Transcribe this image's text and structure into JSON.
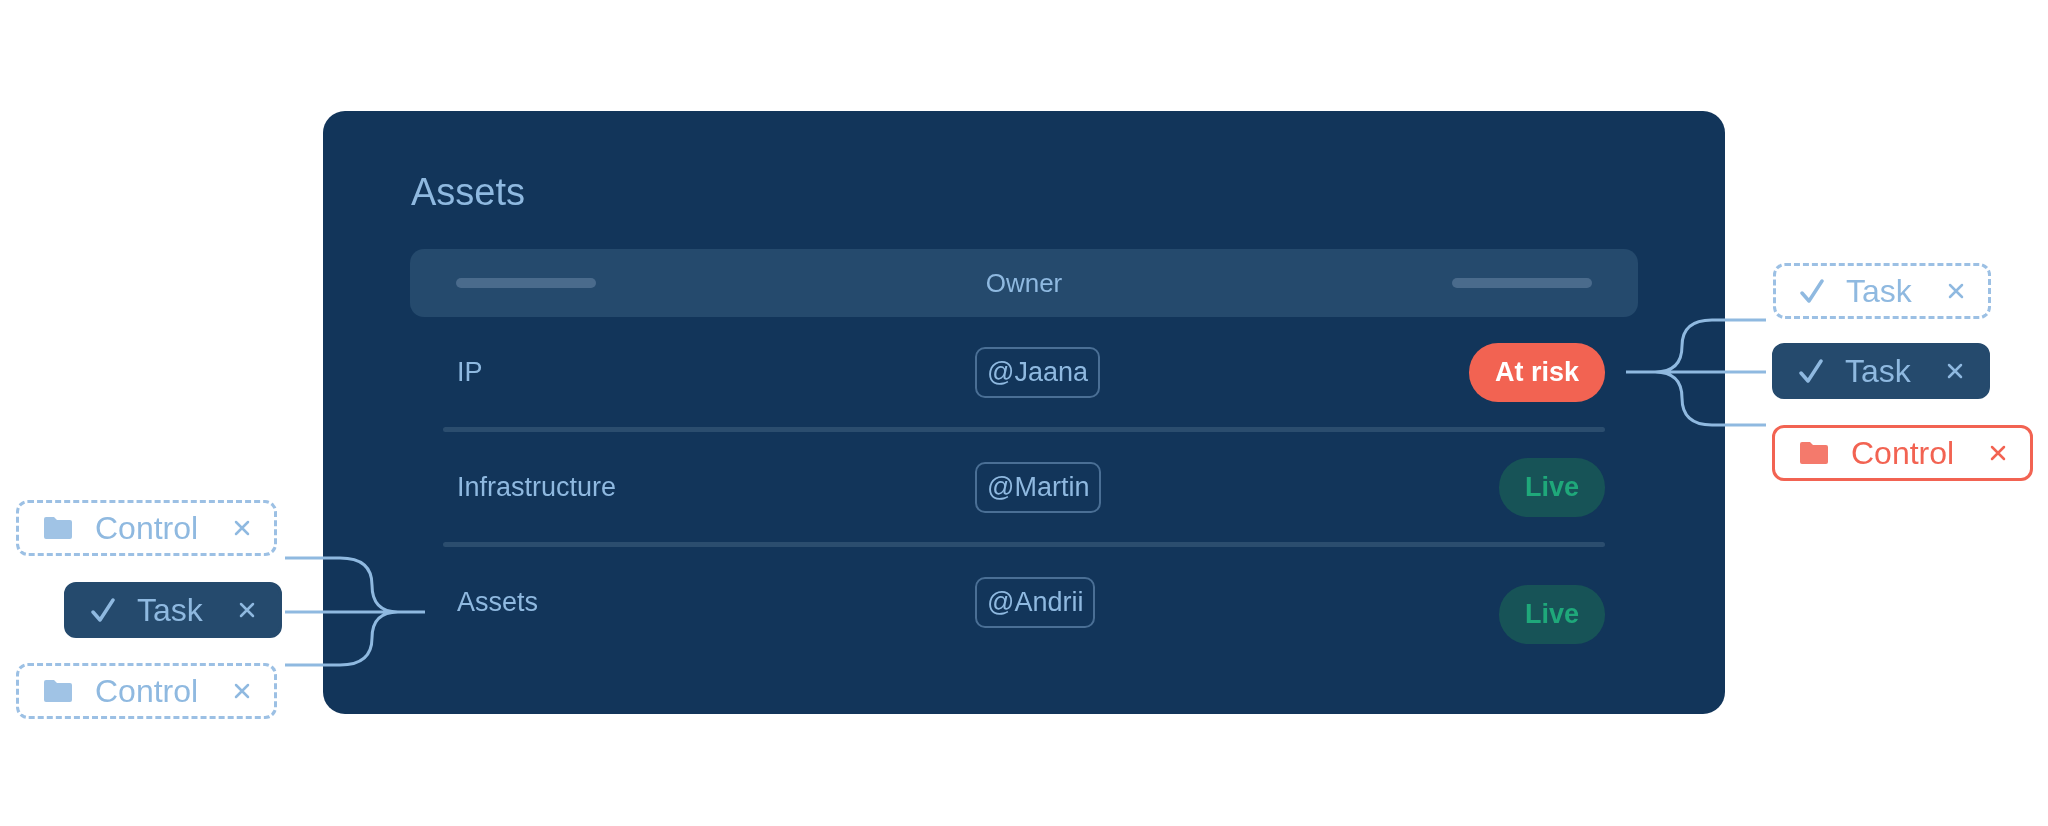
{
  "card": {
    "title": "Assets",
    "header": {
      "label": "Owner"
    },
    "rows": [
      {
        "name": "IP",
        "owner": "@Jaana",
        "status": {
          "label": "At risk",
          "kind": "risk"
        }
      },
      {
        "name": "Infrastructure",
        "owner": "@Martin",
        "status": {
          "label": "Live",
          "kind": "live"
        }
      },
      {
        "name": "Assets",
        "owner": "@Andrii",
        "status": {
          "label": "Live",
          "kind": "live"
        }
      }
    ]
  },
  "left_chips": [
    {
      "label": "Control",
      "kind": "control",
      "selected": false,
      "error": false
    },
    {
      "label": "Task",
      "kind": "task",
      "selected": true,
      "error": false
    },
    {
      "label": "Control",
      "kind": "control",
      "selected": false,
      "error": false
    }
  ],
  "right_chips": [
    {
      "label": "Task",
      "kind": "task",
      "selected": false,
      "error": false
    },
    {
      "label": "Task",
      "kind": "task",
      "selected": true,
      "error": false
    },
    {
      "label": "Control",
      "kind": "control",
      "selected": false,
      "error": true
    }
  ]
}
